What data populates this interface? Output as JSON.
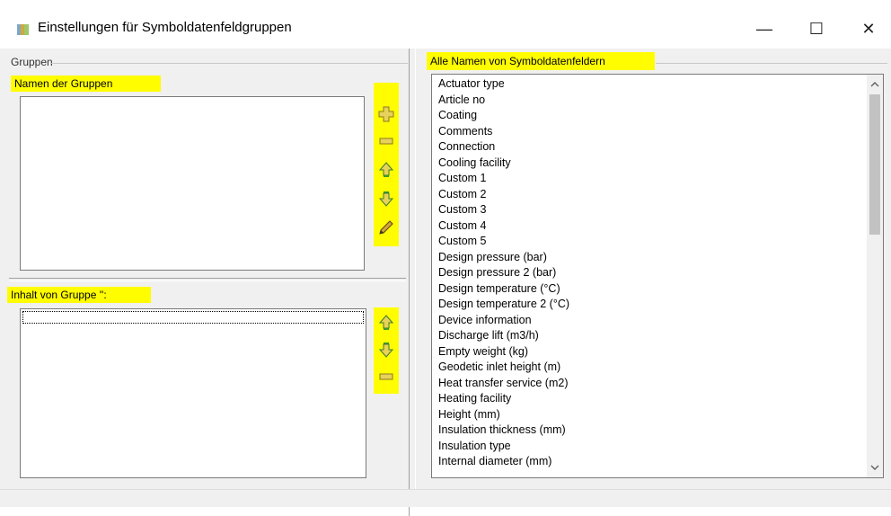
{
  "window": {
    "title": "Einstellungen für Symboldatenfeldgruppen",
    "min_glyph": "—",
    "max_glyph": "☐",
    "close_glyph": "✕"
  },
  "left": {
    "groupbox_title": "Gruppen",
    "groups_label": "Namen der Gruppen",
    "group_content_label": "Inhalt von Gruppe '':",
    "groups_toolbar": [
      "plus-icon",
      "minus-icon",
      "arrow-up-icon",
      "arrow-down-icon",
      "pencil-icon"
    ],
    "content_toolbar": [
      "arrow-up-icon",
      "arrow-down-icon",
      "minus-icon"
    ]
  },
  "right": {
    "label": "Alle Namen von Symboldatenfeldern",
    "fields": [
      "Actuator type",
      "Article no",
      "Coating",
      "Comments",
      "Connection",
      "Cooling facility",
      "Custom 1",
      "Custom 2",
      "Custom 3",
      "Custom 4",
      "Custom 5",
      "Design pressure (bar)",
      "Design pressure 2 (bar)",
      "Design temperature (°C)",
      "Design temperature 2 (°C)",
      "Device information",
      "Discharge lift (m3/h)",
      "Empty weight (kg)",
      "Geodetic inlet height (m)",
      "Heat transfer service (m2)",
      "Heating facility",
      "Height (mm)",
      "Insulation thickness (mm)",
      "Insulation type",
      "Internal diameter (mm)"
    ]
  },
  "colors": {
    "highlight": "#fffd00",
    "icon_green": "#3c9a2e",
    "icon_yellow": "#e6b800"
  }
}
